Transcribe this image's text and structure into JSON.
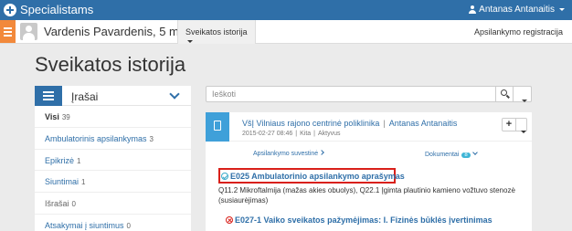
{
  "app": {
    "title": "Specialistams",
    "user": "Antanas Antanaitis"
  },
  "patient": {
    "name": "Vardenis Pavardenis, 5 m.",
    "flag": "✱",
    "history_tab": "Sveikatos istorija",
    "register_link": "Apsilankymo registracija"
  },
  "page": {
    "title": "Sveikatos istorija"
  },
  "sidebar": {
    "header": "Įrašai",
    "items": [
      {
        "label": "Visi",
        "count": "39"
      },
      {
        "label": "Ambulatorinis apsilankymas",
        "count": "3"
      },
      {
        "label": "Epikrizė",
        "count": "1"
      },
      {
        "label": "Siuntimai",
        "count": "1"
      },
      {
        "label": "Išrašai",
        "count": "0"
      },
      {
        "label": "Atsakymai į siuntimus",
        "count": "0"
      }
    ]
  },
  "search": {
    "placeholder": "Ieškoti"
  },
  "record": {
    "org": "VšĮ Vilniaus rajono centrinė poliklinika",
    "separator": "|",
    "doctor": "Antanas Antanaitis",
    "date": "2015-02-27 08:46",
    "meta_separator": "|",
    "type": "Kita",
    "status": "Aktyvus",
    "plus": "+",
    "summary_link": "Apsilankymo suvestinė",
    "docs_link": "Dokumentai",
    "docs_count": "8",
    "entries": [
      {
        "title": "E025 Ambulatorinio apsilankymo aprašymas",
        "description": "Q11.2 Mikroftalmija (mažas akies obuolys), Q22.1 Įgimta plautinio kamieno vožtuvo stenozė (susiaurėjimas)"
      },
      {
        "title": "E027-1 Vaiko sveikatos pažymėjimas: I. Fizinės būklės įvertinimas"
      }
    ]
  },
  "colors": {
    "navbar": "#2f6fa8",
    "accent_orange": "#f2893b",
    "highlight": "#d9201a",
    "teal": "#3fb5d6"
  }
}
